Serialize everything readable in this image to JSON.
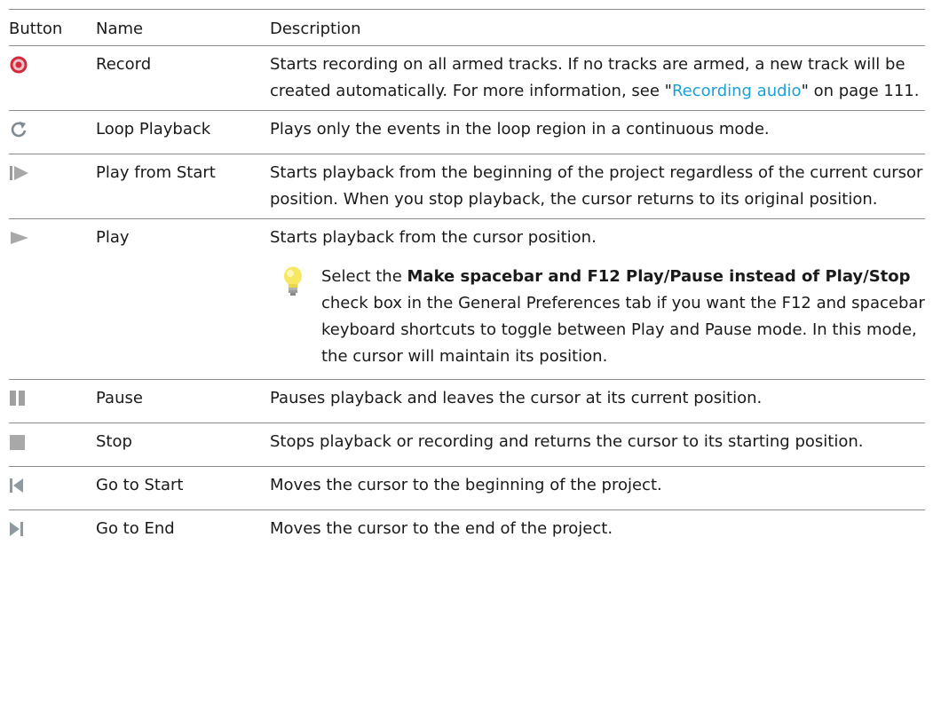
{
  "headers": {
    "button": "Button",
    "name": "Name",
    "description": "Description"
  },
  "rows": [
    {
      "icon": "record-icon",
      "name": "Record",
      "desc_before": "Starts recording on all armed tracks. If no tracks are armed, a new track will be created automatically. For more information, see \"",
      "desc_link": "Recording audio",
      "desc_after": "\" on page 111."
    },
    {
      "icon": "loop-icon",
      "name": "Loop Playback",
      "desc": "Plays only the events in the loop region in a continuous mode."
    },
    {
      "icon": "play-from-start-icon",
      "name": "Play from Start",
      "desc": "Starts playback from the beginning of the project regardless of the current cursor position. When you stop playback, the cursor returns to its original position."
    },
    {
      "icon": "play-icon",
      "name": "Play",
      "desc": "Starts playback from the cursor position.",
      "tip_before": "Select the ",
      "tip_bold": "Make spacebar and F12 Play/Pause instead of Play/Stop",
      "tip_after": " check box in the General Preferences tab if you want the F12 and spacebar keyboard shortcuts to toggle between Play and Pause mode. In this mode, the cursor will maintain its position."
    },
    {
      "icon": "pause-icon",
      "name": "Pause",
      "desc": "Pauses playback and leaves the cursor at its current position."
    },
    {
      "icon": "stop-icon",
      "name": "Stop",
      "desc": "Stops playback or recording and returns the cursor to its starting position."
    },
    {
      "icon": "go-to-start-icon",
      "name": "Go to Start",
      "desc": "Moves the cursor to the beginning of the project."
    },
    {
      "icon": "go-to-end-icon",
      "name": "Go to End",
      "desc": "Moves the cursor to the end of the project."
    }
  ],
  "colors": {
    "link": "#1aa0d8",
    "record": "#d42a3c",
    "icon_gray": "#8a8a8a",
    "rule": "#8c8c8c"
  }
}
